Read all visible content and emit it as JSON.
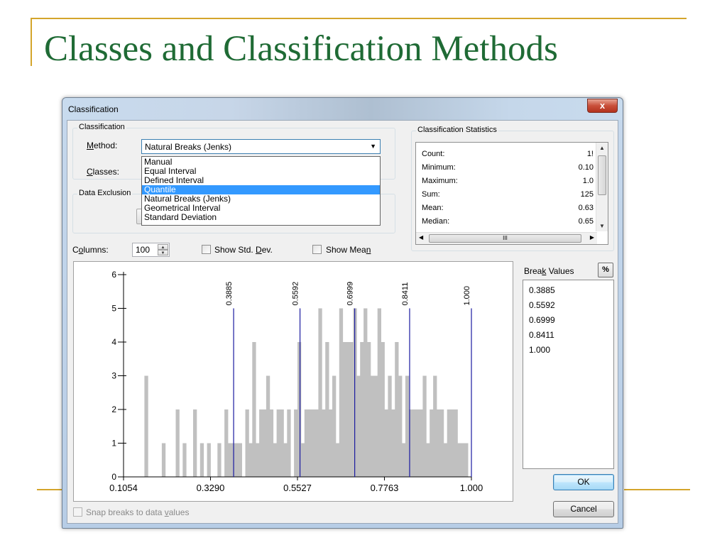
{
  "slide": {
    "title": "Classes and Classification Methods"
  },
  "dialog": {
    "title": "Classification",
    "close_glyph": "x",
    "classification_group": {
      "legend": "Classification",
      "method_label_pre": "",
      "method_label_u": "M",
      "method_label_post": "ethod:",
      "method_value": "Natural Breaks (Jenks)",
      "classes_label_u": "C",
      "classes_label_post": "lasses:",
      "options": [
        "Manual",
        "Equal Interval",
        "Defined Interval",
        "Quantile",
        "Natural Breaks (Jenks)",
        "Geometrical Interval",
        "Standard Deviation"
      ],
      "highlighted_option": "Quantile"
    },
    "data_exclusion_group": {
      "legend": "Data Exclusion"
    },
    "statistics": {
      "legend": "Classification Statistics",
      "rows": [
        {
          "label": "Count:",
          "value": "1!"
        },
        {
          "label": "Minimum:",
          "value": "0.10"
        },
        {
          "label": "Maximum:",
          "value": "1.0"
        },
        {
          "label": "Sum:",
          "value": "125"
        },
        {
          "label": "Mean:",
          "value": "0.63"
        },
        {
          "label": "Median:",
          "value": "0.65"
        }
      ],
      "scroll_thumb_glyph": "III"
    },
    "columns": {
      "label_pre": "C",
      "label_u": "o",
      "label_post": "lumns:",
      "value": "100"
    },
    "show_std_dev": {
      "label_pre": "Show Std. ",
      "label_u": "D",
      "label_post": "ev.",
      "checked": false
    },
    "show_mean": {
      "label_pre": "Show Mea",
      "label_u": "n",
      "label_post": "",
      "checked": false
    },
    "break_values": {
      "label_pre": "Brea",
      "label_u": "k",
      "label_post": " Values",
      "percent_label": "%",
      "values": [
        "0.3885",
        "0.5592",
        "0.6999",
        "0.8411",
        "1.000"
      ]
    },
    "ok_label": "OK",
    "cancel_label": "Cancel",
    "snap": {
      "label_pre": "Snap breaks to data ",
      "label_u": "v",
      "label_post": "alues",
      "checked": false
    }
  },
  "colors": {
    "title_green": "#1f6b35",
    "accent_gold": "#d4a52c",
    "bar_gray": "#c0c0c0",
    "break_line_blue": "#1a1aa0",
    "selection_blue": "#3399ff"
  },
  "chart_data": {
    "type": "bar",
    "title": "",
    "xlabel": "",
    "ylabel": "",
    "x_tick_labels": [
      "0.1054",
      "0.3290",
      "0.5527",
      "0.7763",
      "1.000"
    ],
    "x_ticks": [
      0.1054,
      0.329,
      0.5527,
      0.7763,
      1.0
    ],
    "xlim": [
      0.1054,
      1.0
    ],
    "ylim": [
      0,
      6
    ],
    "y_ticks": [
      0,
      1,
      2,
      3,
      4,
      5,
      6
    ],
    "bin_count": 100,
    "bin_values": [
      0,
      0,
      0,
      0,
      0,
      0,
      3,
      0,
      0,
      0,
      0,
      1,
      0,
      0,
      0,
      2,
      0,
      1,
      0,
      0,
      2,
      0,
      1,
      0,
      1,
      0,
      0,
      1,
      0,
      2,
      1,
      1,
      1,
      1,
      0,
      2,
      1,
      4,
      1,
      2,
      2,
      3,
      2,
      1,
      2,
      2,
      1,
      2,
      0,
      2,
      4,
      1,
      2,
      2,
      2,
      2,
      5,
      2,
      4,
      2,
      3,
      1,
      5,
      4,
      4,
      4,
      5,
      3,
      4,
      5,
      4,
      3,
      3,
      5,
      4,
      2,
      3,
      2,
      4,
      3,
      1,
      3,
      2,
      2,
      2,
      2,
      3,
      1,
      2,
      3,
      2,
      2,
      1,
      2,
      2,
      2,
      1,
      1,
      1,
      0
    ],
    "break_lines": [
      {
        "value": 0.3885,
        "label": "0.3885"
      },
      {
        "value": 0.5592,
        "label": "0.5592"
      },
      {
        "value": 0.6999,
        "label": "0.6999"
      },
      {
        "value": 0.8411,
        "label": "0.8411"
      },
      {
        "value": 1.0,
        "label": "1.000"
      }
    ],
    "grid": false,
    "legend": "none"
  }
}
